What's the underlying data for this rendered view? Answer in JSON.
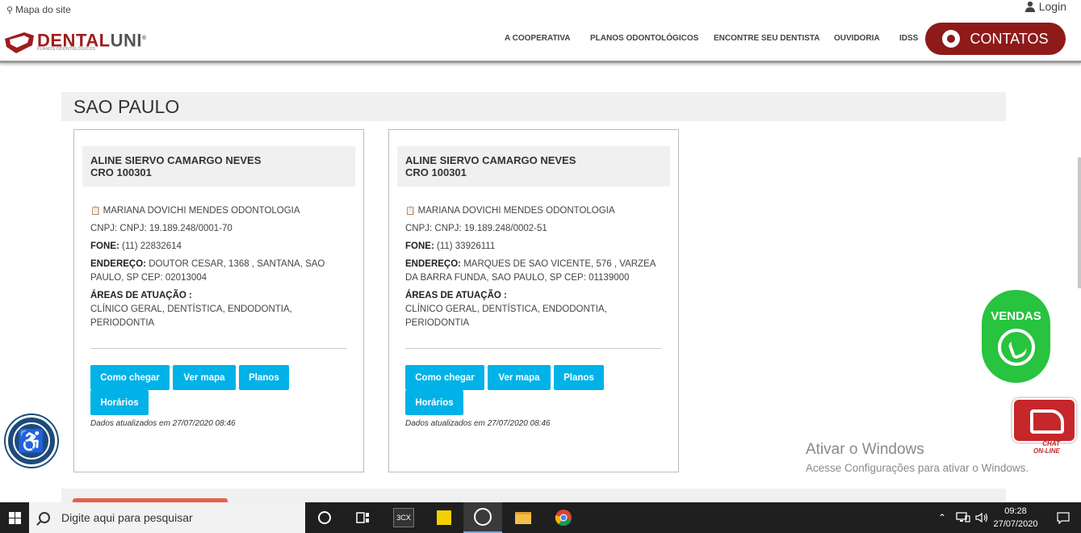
{
  "header": {
    "sitemap_label": "Mapa do site",
    "login_label": "Login",
    "logo": {
      "dental": "DENTAL",
      "uni": "UNI",
      "registered": "®",
      "tagline": "PLANOS ODONTOLÓGICOS"
    },
    "nav": [
      "A COOPERATIVA",
      "PLANOS ODONTOLÓGICOS",
      "ENCONTRE SEU DENTISTA",
      "OUVIDORIA",
      "IDSS"
    ],
    "contatos_label": "CONTATOS",
    "brand_color": "#8e1a1a"
  },
  "city": "SAO PAULO",
  "cards": [
    {
      "name": "ALINE SIERVO CAMARGO NEVES",
      "cro": "CRO 100301",
      "clinic": "MARIANA DOVICHI MENDES ODONTOLOGIA",
      "cnpj": "CNPJ: CNPJ: 19.189.248/0001-70",
      "fone_label": "FONE:",
      "fone": "(11) 22832614",
      "endereco_label": "ENDEREÇO:",
      "endereco": "DOUTOR CESAR, 1368 , SANTANA, SAO PAULO, SP CEP: 02013004",
      "areas_label": "ÁREAS DE ATUAÇÃO :",
      "areas": "CLÍNICO GERAL, DENTÍSTICA, ENDODONTIA, PERIODONTIA",
      "buttons": [
        "Como chegar",
        "Ver mapa",
        "Planos",
        "Horários"
      ],
      "updated": "Dados atualizados em 27/07/2020 08:46"
    },
    {
      "name": "ALINE SIERVO CAMARGO NEVES",
      "cro": "CRO 100301",
      "clinic": "MARIANA DOVICHI MENDES ODONTOLOGIA",
      "cnpj": "CNPJ: CNPJ: 19.189.248/0002-51",
      "fone_label": "FONE:",
      "fone": "(11) 33926111",
      "endereco_label": "ENDEREÇO:",
      "endereco": "MARQUES DE SAO VICENTE, 576 , VARZEA DA BARRA FUNDA, SAO PAULO, SP CEP: 01139000",
      "areas_label": "ÁREAS DE ATUAÇÃO :",
      "areas": "CLÍNICO GERAL, DENTÍSTICA, ENDODONTIA, PERIODONTIA",
      "buttons": [
        "Como chegar",
        "Ver mapa",
        "Planos",
        "Horários"
      ],
      "updated": "Dados atualizados em 27/07/2020 08:46"
    }
  ],
  "widgets": {
    "vendas_label": "VENDAS",
    "chat_label_1": "CHAT",
    "chat_label_2": "ON-LINE",
    "whatsapp_color": "#28c33f",
    "button_color": "#00b2e8"
  },
  "activation": {
    "title": "Ativar o Windows",
    "subtitle": "Acesse Configurações para ativar o Windows."
  },
  "taskbar": {
    "search_placeholder": "Digite aqui para pesquisar",
    "time": "09:28",
    "date": "27/07/2020",
    "app_3cx": "3CX"
  }
}
